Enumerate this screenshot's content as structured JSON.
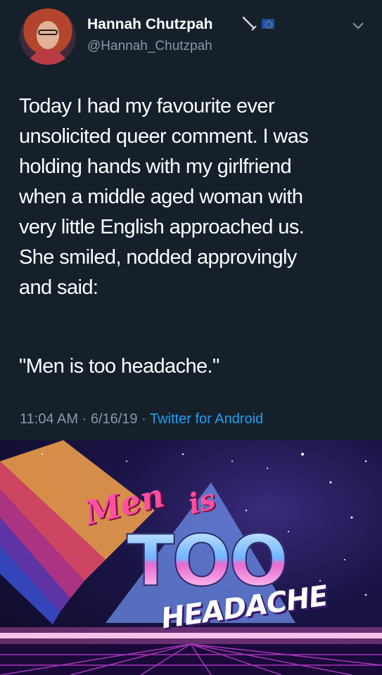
{
  "tweet": {
    "author_name": "Hannah Chutzpah",
    "author_handle": "@Hannah_Chutzpah",
    "body": "Today I had my favourite ever\nunsolicited queer comment. I was\nholding hands with my girlfriend\nwhen a middle aged woman with\nvery little English approached us.\nShe smiled, nodded approvingly\nand said:",
    "quote": "\"Men is too headache.\"",
    "time": "11:04 AM",
    "separator": "·",
    "date": "6/16/19",
    "source": "Twitter for Android",
    "icons": [
      "avatar",
      "sword-icon",
      "eu-flag-icon",
      "chevron-down-icon"
    ],
    "colors": {
      "background": "#15202b",
      "secondary_text": "#8899a6",
      "link": "#1da1f2"
    }
  },
  "meme": {
    "line1": "Men",
    "line2": "is",
    "line3": "TOO",
    "line4": "HEADACHE"
  }
}
